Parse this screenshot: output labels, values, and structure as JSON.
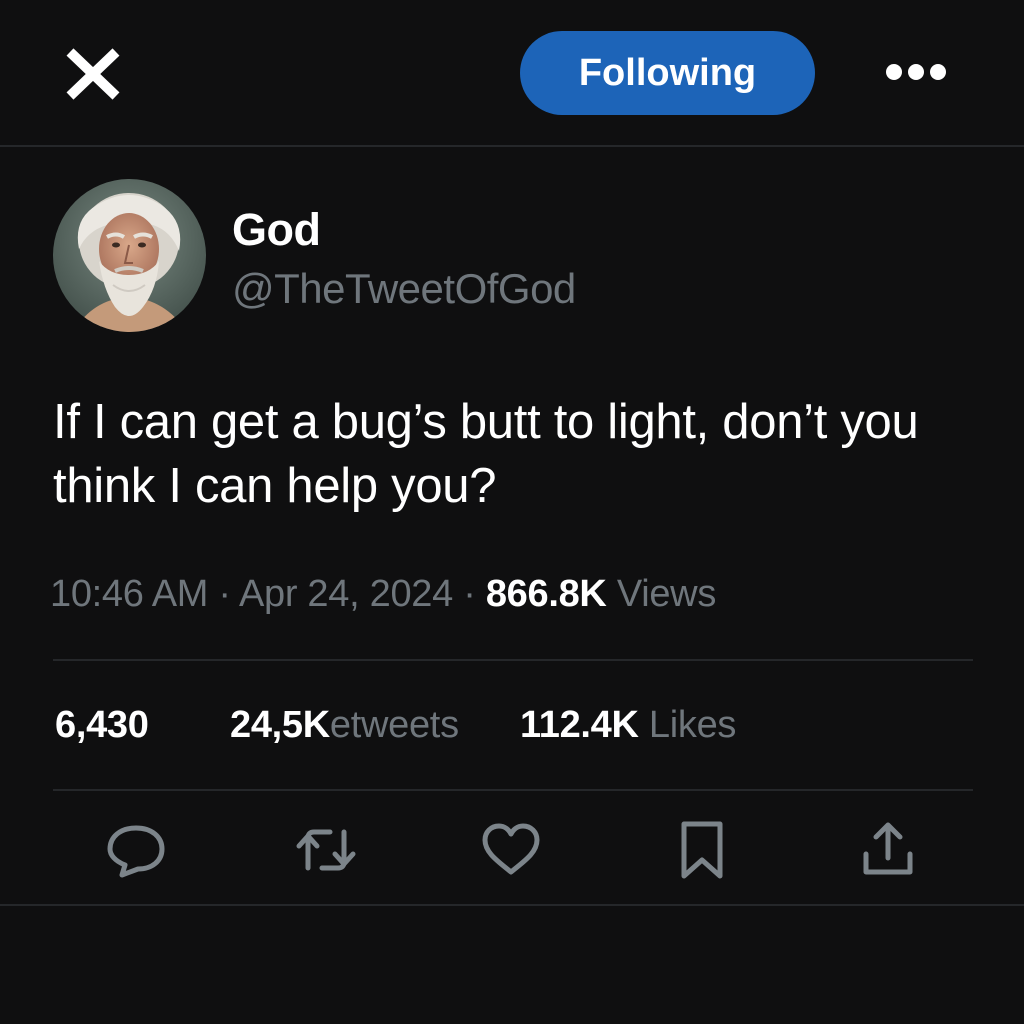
{
  "header": {
    "logo_icon": "x-logo-icon",
    "follow_label": "Following",
    "more_icon": "more-dots-icon"
  },
  "author": {
    "display_name": "God",
    "handle": "@TheTweetOfGod",
    "avatar_icon": "avatar-portrait"
  },
  "tweet": {
    "text": "If I can get a bug’s butt to light, don’t you think I can help you?",
    "time": "10:46 AM",
    "separator": " · ",
    "date": "Apr 24, 2024",
    "views_count": "866.8K",
    "views_label": " Views"
  },
  "stats": {
    "replies": {
      "count": "6,430",
      "label": ""
    },
    "retweets": {
      "count": "24,5K",
      "label": "etweets"
    },
    "likes": {
      "count": "112.4K",
      "label": " Likes"
    }
  },
  "actions": [
    {
      "icon": "reply-icon"
    },
    {
      "icon": "retweet-icon"
    },
    {
      "icon": "like-heart-icon"
    },
    {
      "icon": "bookmark-icon"
    },
    {
      "icon": "share-icon"
    }
  ],
  "colors": {
    "background": "#0f0f10",
    "accent": "#1d64b8",
    "text_primary": "#ffffff",
    "text_secondary": "#6f767c",
    "divider": "#25272a"
  }
}
